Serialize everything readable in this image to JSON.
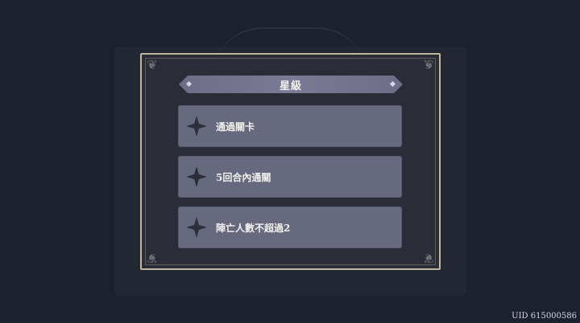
{
  "panel": {
    "title": "星級"
  },
  "conditions": [
    {
      "label": "通過關卡",
      "icon": "star-icon"
    },
    {
      "label": "5回合內通關",
      "icon": "star-icon"
    },
    {
      "label": "陣亡人數不超過2",
      "icon": "star-icon"
    }
  ],
  "footer": {
    "uid": "UID 615000586"
  },
  "colors": {
    "background": "#1c2130",
    "panel": "#2a2d38",
    "panel_border": "#c2b79a",
    "title_bar": "#7a7a96",
    "item_bg": "#676a7f",
    "star": "#2c2e3c"
  }
}
